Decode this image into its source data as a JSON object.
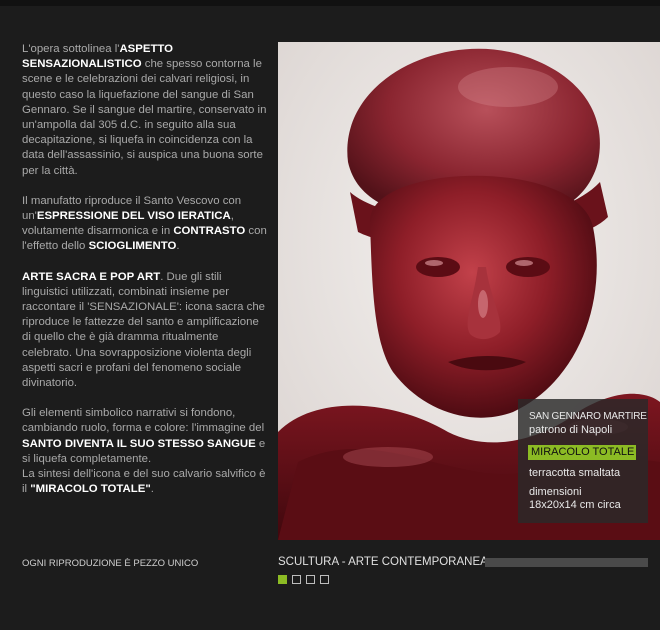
{
  "description": {
    "p1": {
      "a": "L'opera sottolinea l'",
      "b": "ASPETTO SENSAZIONALISTICO",
      "c": " che spesso contorna le scene e le celebrazioni dei calvari religiosi, in questo caso la liquefazione del sangue di San Gennaro. Se il sangue del martire, conservato in un'ampolla dal 305 d.C. in seguito alla sua decapitazione, si liquefa in coincidenza con la data dell'assassinio, si auspica una buona sorte per la città."
    },
    "p2": {
      "a": "Il manufatto riproduce il Santo Vescovo con un'",
      "b": "ESPRESSIONE DEL VISO IERATICA",
      "c": ", volutamente disarmonica e in ",
      "d": "CONTRASTO",
      "e": " con l'effetto dello ",
      "f": "SCIOGLIMENTO",
      "g": "."
    },
    "p3": {
      "a": "ARTE SACRA E POP ART",
      "b": ". Due gli stili linguistici utilizzati, combinati insieme per raccontare il 'SENSAZIONALE': icona sacra che riproduce le fattezze del santo e amplificazione di quello che è già dramma ritualmente celebrato. Una sovrapposizione violenta degli aspetti sacri e profani del fenomeno sociale divinatorio."
    },
    "p4": {
      "a": "Gli elementi simbolico narrativi si fondono, cambiando ruolo, forma e colore: l'immagine del ",
      "b": "SANTO DIVENTA IL SUO STESSO SANGUE",
      "c": " e si liquefa completamente.",
      "d": "La sintesi dell'icona e del suo calvario salvifico è il ",
      "e": "\"MIRACOLO TOTALE\"",
      "f": "."
    }
  },
  "caption": {
    "title": "SAN GENNARO MARTIRE",
    "subtitle": "patrono di Napoli",
    "highlight": "MIRACOLO TOTALE",
    "material": "terracotta smaltata",
    "dimensions_label": "dimensioni",
    "dimensions_value": "18x20x14 cm circa"
  },
  "footer": {
    "left": "OGNI RIPRODUZIONE È PEZZO UNICO",
    "category": "SCULTURA - ARTE CONTEMPORANEA"
  },
  "pager": {
    "total": 4,
    "active": 1
  },
  "colors": {
    "accent": "#8cbb24",
    "background": "#1c1c1c",
    "sculpture": "#8e1e28"
  }
}
